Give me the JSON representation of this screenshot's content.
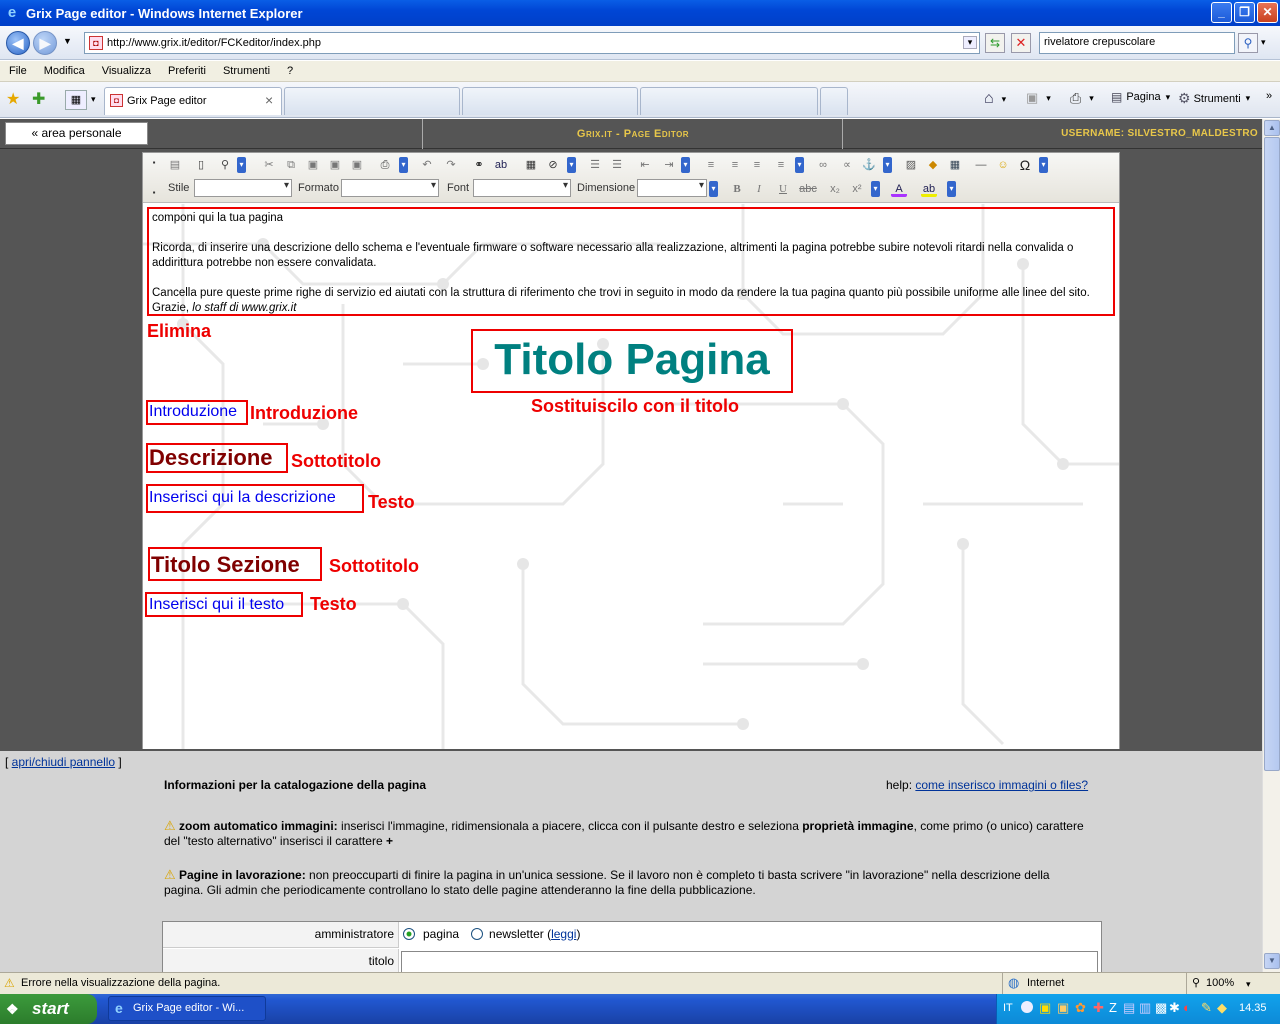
{
  "window": {
    "title": "Grix Page editor - Windows Internet Explorer"
  },
  "address_bar": {
    "url": "http://www.grix.it/editor/FCKeditor/index.php",
    "search_text": "rivelatore crepuscolare"
  },
  "menu": [
    "File",
    "Modifica",
    "Visualizza",
    "Preferiti",
    "Strumenti",
    "?"
  ],
  "tabs": {
    "active": "Grix Page editor",
    "close": "×"
  },
  "commandbar": {
    "pagina": "Pagina",
    "strumenti": "Strumenti"
  },
  "site_header": {
    "area_button": "« area personale",
    "title": "Grix.it - Page Editor",
    "username": "USERNAME: SILVESTRO_MALDESTRO"
  },
  "editor_toolbar": {
    "stile": "Stile",
    "formato": "Formato",
    "font": "Font",
    "dimensione": "Dimensione"
  },
  "note": {
    "line1": "componi qui la tua pagina",
    "line2": "Ricorda, di inserire una descrizione dello schema e l'eventuale firmware o software necessario alla realizzazione, altrimenti la pagina potrebbe subire notevoli ritardi nella convalida o addirittura potrebbe non essere convalidata.",
    "line3": "Cancella pure queste prime righe di servizio ed aiutati con la struttura di riferimento che trovi in seguito in modo da rendere la tua pagina quanto più possibile uniforme alle linee del sito. Grazie, ",
    "line3_italic": "lo staff di www.grix.it"
  },
  "template": {
    "elimina": "Elimina",
    "titolo_pagina": "Titolo Pagina",
    "titolo_hint": "Sostituiscilo con il titolo",
    "introduzione": "Introduzione",
    "introduzione_hint": "Introduzione",
    "descrizione": "Descrizione",
    "descrizione_hint": "Sottotitolo",
    "inserisci_descrizione": "Inserisci qui la descrizione",
    "inserisci_descrizione_hint": "Testo",
    "titolo_sezione": "Titolo Sezione",
    "titolo_sezione_hint": "Sottotitolo",
    "inserisci_testo": "Inserisci qui il testo",
    "inserisci_testo_hint": "Testo"
  },
  "lower_panel": {
    "toggle_link": "apri/chiudi pannello",
    "info_title": "Informazioni per la catalogazione della pagina",
    "help_label": "help:",
    "help_link": "come inserisco immagini o files?",
    "zoom_bold": "zoom automatico immagini:",
    "zoom_text1": " inserisci l'immagine, ridimensionala a piacere, clicca con il pulsante destro e seleziona ",
    "zoom_bold2": "proprietà immagine",
    "zoom_text2": ", come primo (o unico) carattere del \"testo alternativo\" inserisci il carattere ",
    "zoom_plus": "+",
    "lavorazione_bold": "Pagine in lavorazione:",
    "lavorazione_text": " non preoccuparti di finire la pagina in un'unica sessione. Se il lavoro non è completo ti basta scrivere \"in lavorazione\" nella descrizione della pagina. Gli admin che periodicamente controllano lo stato delle pagine attenderanno la fine della pubblicazione.",
    "form": {
      "amministratore_label": "amministratore",
      "opt_pagina": "pagina",
      "opt_newsletter": "newsletter (",
      "leggi": "leggi",
      "close_paren": ")",
      "titolo_label": "titolo"
    }
  },
  "statusbar": {
    "message": "Errore nella visualizzazione della pagina.",
    "zone": "Internet",
    "zoom": "100%"
  },
  "taskbar": {
    "start": "start",
    "item": "Grix Page editor - Wi...",
    "lang": "IT",
    "clock": "14.35"
  },
  "colors": {
    "accent_red": "#e00000",
    "teal_title": "#008080",
    "link_blue": "#0000ee",
    "dark_red": "#800000",
    "header_gold": "#e8c74a"
  }
}
